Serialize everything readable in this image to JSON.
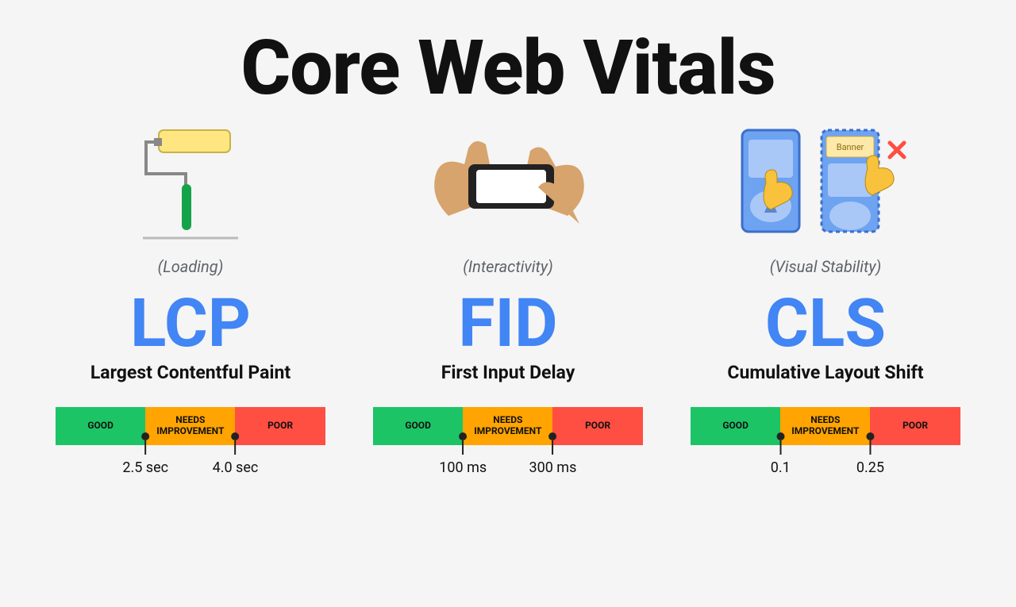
{
  "title": "Core Web Vitals",
  "bar_labels": {
    "good": "GOOD",
    "needs": "NEEDS IMPROVEMENT",
    "poor": "POOR"
  },
  "metrics": [
    {
      "aspect": "(Loading)",
      "abbr": "LCP",
      "name": "Largest Contentful Paint",
      "thresholds": [
        "2.5 sec",
        "4.0 sec"
      ],
      "icon": "paint-roller-icon"
    },
    {
      "aspect": "(Interactivity)",
      "abbr": "FID",
      "name": "First Input Delay",
      "thresholds": [
        "100 ms",
        "300 ms"
      ],
      "icon": "phone-tap-icon"
    },
    {
      "aspect": "(Visual Stability)",
      "abbr": "CLS",
      "name": "Cumulative Layout Shift",
      "thresholds": [
        "0.1",
        "0.25"
      ],
      "icon": "layout-shift-icon",
      "banner_label": "Banner"
    }
  ]
}
